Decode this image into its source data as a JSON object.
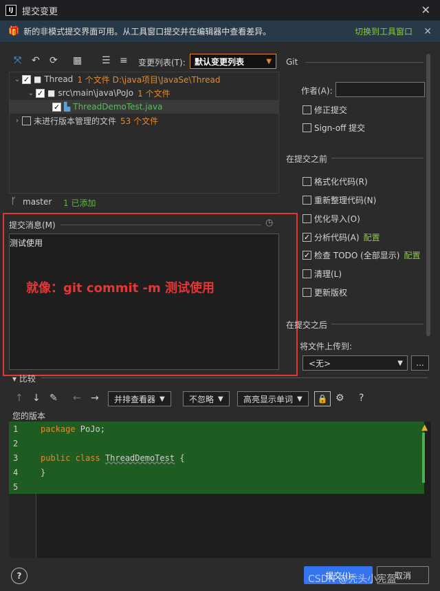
{
  "window": {
    "title": "提交变更",
    "logo_text": "IJ"
  },
  "banner": {
    "text": "新的非模式提交界面可用。从工具窗口提交并在编辑器中查看差异。",
    "link": "切换到工具窗口"
  },
  "toolbar": {
    "changelist_label": "变更列表(T):",
    "changelist_value": "默认变更列表"
  },
  "tree": {
    "rows": [
      {
        "name": "Thread",
        "info": "1 个文件  D:\\java项目\\JavaSe\\Thread"
      },
      {
        "name": "src\\main\\java\\PoJo",
        "info": "1 个文件"
      },
      {
        "name": "ThreadDemoTest.java"
      },
      {
        "name": "未进行版本管理的文件",
        "info": "53 个文件"
      }
    ]
  },
  "branch": {
    "name": "master",
    "added": "1 已添加"
  },
  "commit": {
    "header": "提交消息(M)",
    "message": "测试使用",
    "annotation": "就像：git commit -m 测试使用"
  },
  "git_panel": {
    "section_git": "Git",
    "author_label": "作者(A):",
    "amend": "修正提交",
    "signoff": "Sign-off 提交",
    "section_before": "在提交之前",
    "before_options": [
      {
        "label": "格式化代码(R)",
        "checked": false
      },
      {
        "label": "重新整理代码(N)",
        "checked": false
      },
      {
        "label": "优化导入(O)",
        "checked": false
      },
      {
        "label": "分析代码(A)",
        "checked": true,
        "config": "配置"
      },
      {
        "label": "检查 TODO (全部显示)",
        "checked": true,
        "config": "配置"
      },
      {
        "label": "清理(L)",
        "checked": false
      },
      {
        "label": "更新版权",
        "checked": false
      }
    ],
    "section_after": "在提交之后",
    "upload_label": "将文件上传到:",
    "upload_value": "<无>",
    "upload_more": "..."
  },
  "diff": {
    "header": "比较",
    "viewer": "并排查看器",
    "ignore": "不忽略",
    "highlight": "高亮显示单词",
    "help": "?",
    "your_version": "您的版本",
    "lines": [
      {
        "n": "1",
        "kw": "package",
        "rest": " PoJo;"
      },
      {
        "n": "2",
        "kw": "",
        "rest": ""
      },
      {
        "n": "3",
        "kw": "public class",
        "cls": "ThreadDemoTest",
        "rest": " {"
      },
      {
        "n": "4",
        "kw": "",
        "rest": "}"
      },
      {
        "n": "5",
        "kw": "",
        "rest": ""
      }
    ]
  },
  "footer": {
    "help": "?",
    "commit_label": "提交(I)",
    "cancel_label": "取消",
    "watermark": "CSDN @秃头小宪盔"
  }
}
